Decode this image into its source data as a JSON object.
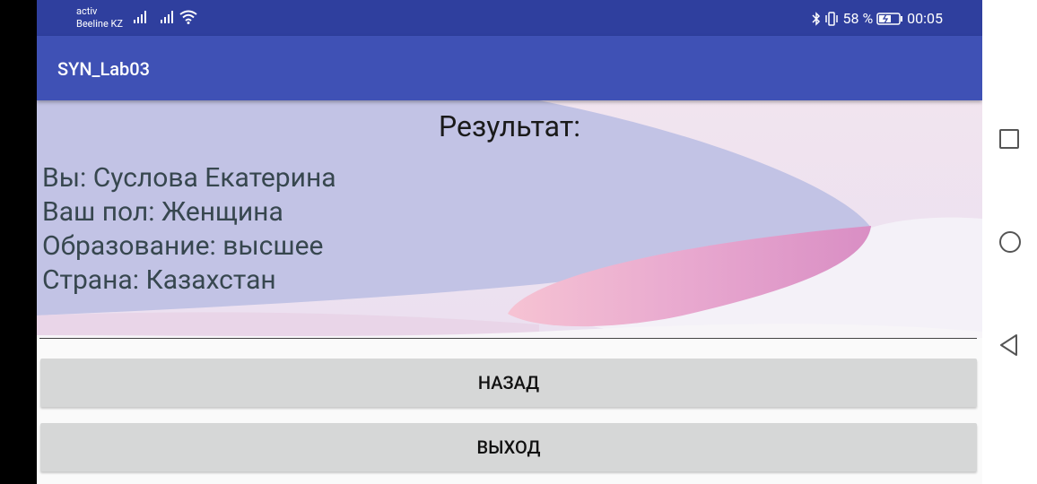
{
  "status_bar": {
    "carrier_line1": "activ",
    "carrier_line2": "Beeline KZ",
    "battery_percent": "58 %",
    "time": "00:05",
    "icons": [
      "signal-icon",
      "signal-icon",
      "wifi-icon",
      "bluetooth-icon",
      "vibrate-icon",
      "battery-icon"
    ]
  },
  "app_bar": {
    "title": "SYN_Lab03"
  },
  "result": {
    "heading": "Результат:",
    "lines": [
      "Вы: Суслова Екатерина",
      "Ваш пол: Женщина",
      "Образование: высшее",
      "Страна: Казахстан"
    ]
  },
  "buttons": {
    "back": "НАЗАД",
    "exit": "ВЫХОД"
  },
  "nav_bar": {
    "icons": [
      "recent-apps-icon",
      "home-icon",
      "back-icon"
    ]
  },
  "colors": {
    "status_bar": "#2f3f9e",
    "app_bar": "#3f51b5",
    "button": "#d6d7d7"
  }
}
